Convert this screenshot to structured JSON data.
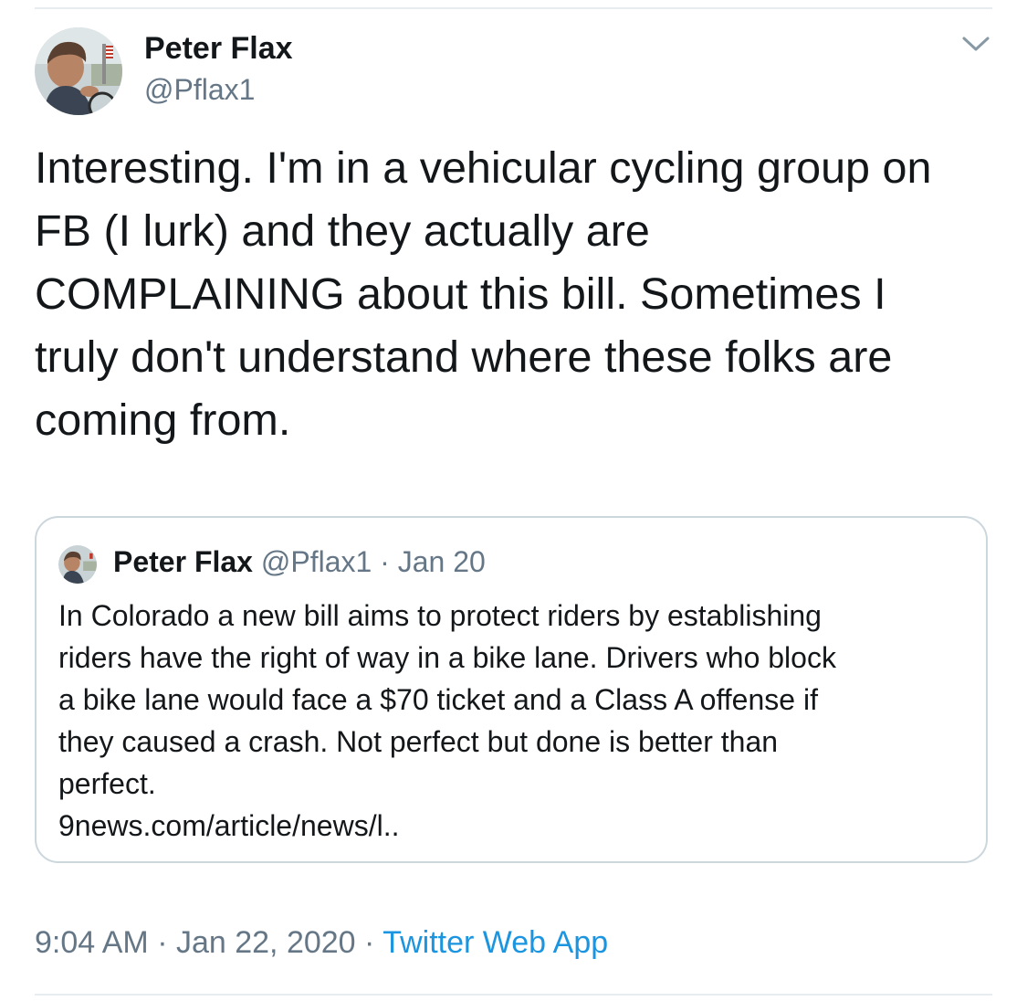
{
  "author": {
    "display_name": "Peter Flax",
    "handle": "@Pflax1"
  },
  "tweet": {
    "text": "Interesting. I'm in a vehicular cycling group on\nFB (I lurk) and they actually are\nCOMPLAINING about this bill. Sometimes I\ntruly don't understand where these folks are\ncoming from."
  },
  "quoted_tweet": {
    "display_name": "Peter Flax",
    "handle": "@Pflax1",
    "separator": " · ",
    "date": "Jan 20",
    "text": "In Colorado a new bill aims to protect riders by establishing\nriders have the right of way in a bike lane. Drivers who block\na bike lane would face a $70 ticket and a Class A offense if\nthey caused a crash. Not perfect but done is better than\nperfect.",
    "link": "9news.com/article/news/l.."
  },
  "footer": {
    "time": "9:04 AM",
    "separator_1": " · ",
    "date": "Jan 22, 2020",
    "separator_2": " · ",
    "source": "Twitter Web App"
  },
  "colors": {
    "text_primary": "#14171a",
    "text_secondary": "#657786",
    "link": "#1b95e0",
    "border": "#ccd6dd",
    "divider": "#e6ecf0"
  },
  "icons": {
    "menu": "chevron-down-icon"
  }
}
